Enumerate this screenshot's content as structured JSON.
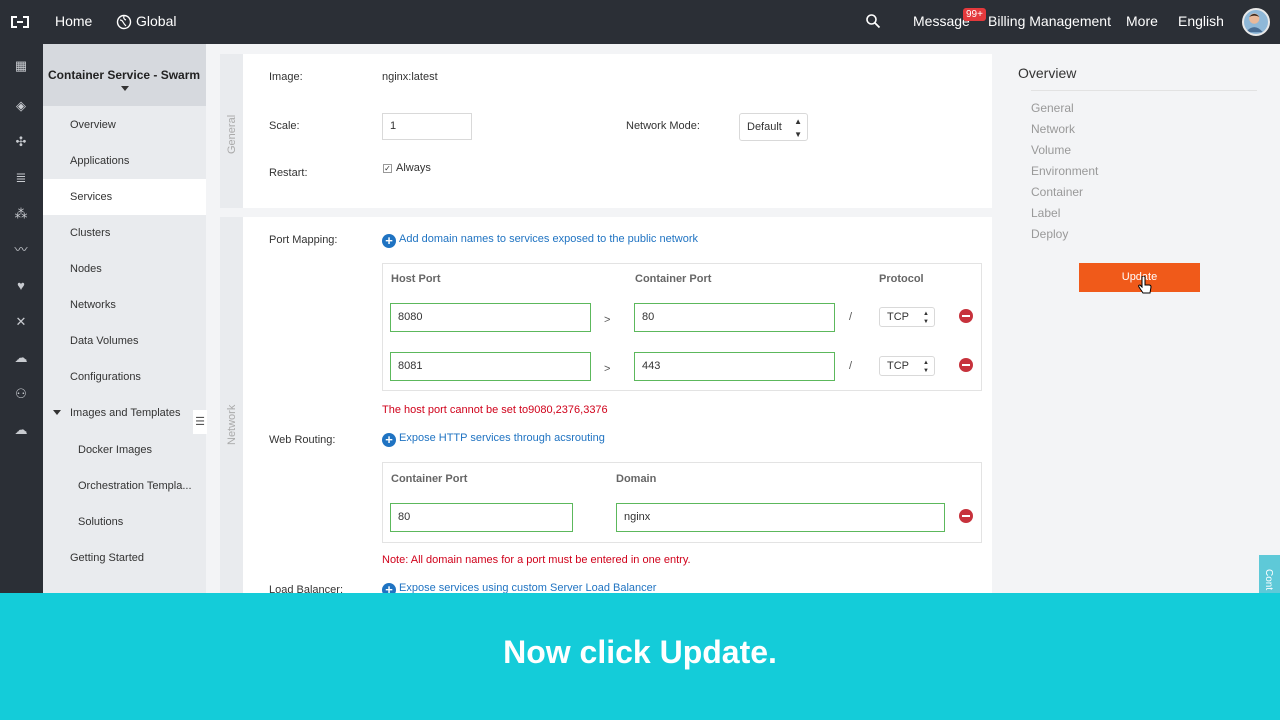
{
  "topbar": {
    "home": "Home",
    "region": "Global",
    "message": "Message",
    "message_badge": "99+",
    "billing": "Billing Management",
    "more": "More",
    "language": "English"
  },
  "sidebar": {
    "title": "Container Service - Swarm",
    "items": [
      {
        "label": "Overview"
      },
      {
        "label": "Applications"
      },
      {
        "label": "Services"
      },
      {
        "label": "Clusters"
      },
      {
        "label": "Nodes"
      },
      {
        "label": "Networks"
      },
      {
        "label": "Data Volumes"
      },
      {
        "label": "Configurations"
      },
      {
        "label": "Images and Templates"
      },
      {
        "label": "Docker Images"
      },
      {
        "label": "Orchestration Templa..."
      },
      {
        "label": "Solutions"
      },
      {
        "label": "Getting Started"
      }
    ]
  },
  "general": {
    "section_label": "General",
    "image_label": "Image:",
    "image_value": "nginx:latest",
    "scale_label": "Scale:",
    "scale_value": "1",
    "network_mode_label": "Network Mode:",
    "network_mode_value": "Default",
    "restart_label": "Restart:",
    "restart_value": "Always"
  },
  "network": {
    "section_label": "Network",
    "port_mapping_label": "Port Mapping:",
    "port_mapping_link": "Add domain names to services exposed to the public network",
    "port_headers": {
      "host": "Host Port",
      "container": "Container Port",
      "protocol": "Protocol"
    },
    "port_rows": [
      {
        "host": "8080",
        "sep": ">",
        "container": "80",
        "slash": "/",
        "protocol": "TCP"
      },
      {
        "host": "8081",
        "sep": ">",
        "container": "443",
        "slash": "/",
        "protocol": "TCP"
      }
    ],
    "port_error": "The host port cannot be set to9080,2376,3376",
    "web_routing_label": "Web Routing:",
    "web_routing_link": "Expose HTTP services through acsrouting",
    "routing_headers": {
      "container": "Container Port",
      "domain": "Domain"
    },
    "routing_rows": [
      {
        "container": "80",
        "domain": "nginx"
      }
    ],
    "routing_note": "Note: All domain names for a port must be entered in one entry.",
    "load_balancer_label": "Load Balancer:",
    "load_balancer_link": "Expose services using custom Server Load Balancer"
  },
  "overview": {
    "title": "Overview",
    "items": [
      "General",
      "Network",
      "Volume",
      "Environment",
      "Container",
      "Label",
      "Deploy"
    ],
    "update_button": "Update"
  },
  "right_tab": "Cont",
  "caption": "Now click Update.",
  "colors": {
    "topbar": "#2b2f36",
    "update": "#f05a1a",
    "caption": "#14ccd9",
    "link": "#1f73c2",
    "error": "#d0021b",
    "valid_border": "#5cb85c"
  }
}
